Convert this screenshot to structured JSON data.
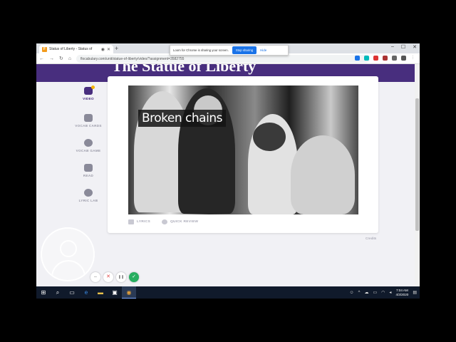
{
  "browser": {
    "tab_title": "Status of Liberty - Status of",
    "new_tab": "+",
    "url": "flocabulary.com/unit/statue-of-liberty/video/?assignment=3582755",
    "minimize": "–",
    "maximize": "☐",
    "close": "✕"
  },
  "share_banner": {
    "text": "Loom for Chrome is sharing your screen.",
    "stop_label": "Stop sharing",
    "hide_label": "Hide"
  },
  "page": {
    "heading": "The Statue of Liberty"
  },
  "sidebar": {
    "items": [
      {
        "label": "VIDEO",
        "icon": "video-icon"
      },
      {
        "label": "VOCAB CARDS",
        "icon": "vocab-cards-icon"
      },
      {
        "label": "VOCAB GAME",
        "icon": "vocab-game-icon"
      },
      {
        "label": "READ",
        "icon": "read-icon"
      },
      {
        "label": "LYRIC LAB",
        "icon": "lyric-lab-icon"
      }
    ]
  },
  "video": {
    "caption": "Broken chains"
  },
  "footer": {
    "lyrics_label": "LYRICS",
    "quick_review_label": "QUICK REVIEW",
    "credits_label": "Credits"
  },
  "recorder": {
    "minus": "–",
    "cancel": "✕",
    "pause": "❚❚",
    "done": "✓"
  },
  "taskbar": {
    "time": "7:04 AM",
    "date": "4/3/2020"
  },
  "colors": {
    "brand_purple": "#482e7e",
    "accent_yellow": "#f5b400",
    "stop_blue": "#1a73e8"
  }
}
